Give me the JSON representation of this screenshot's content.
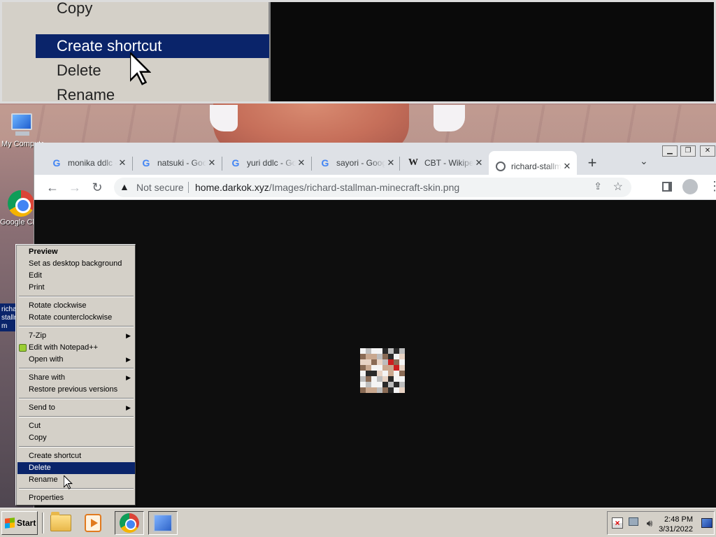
{
  "magnifier": {
    "items": [
      {
        "label": "Copy",
        "highlighted": false
      },
      {
        "label": "Create shortcut",
        "highlighted": true
      },
      {
        "label": "Delete",
        "highlighted": false
      },
      {
        "label": "Rename",
        "highlighted": false
      }
    ]
  },
  "desktop": {
    "icons": [
      {
        "label": "My Computer",
        "icon": "computer-icon"
      },
      {
        "label": "Google Chrome",
        "icon": "chrome-icon"
      }
    ],
    "selected_file_label": "richard-stallman-m"
  },
  "browser": {
    "tabs": [
      {
        "title": "monika ddlc - Google Search",
        "favicon": "google-icon",
        "active": false
      },
      {
        "title": "natsuki - Google Search",
        "favicon": "google-icon",
        "active": false
      },
      {
        "title": "yuri ddlc - Google Search",
        "favicon": "google-icon",
        "active": false
      },
      {
        "title": "sayori - Google Search",
        "favicon": "google-icon",
        "active": false
      },
      {
        "title": "CBT - Wikipedia",
        "favicon": "wikipedia-icon",
        "active": false
      },
      {
        "title": "richard-stallman-minecraft-skin.png",
        "favicon": "globe-icon",
        "active": true
      }
    ],
    "security_label": "Not secure",
    "url_host": "home.darkok.xyz",
    "url_path": "/Images/richard-stallman-minecraft-skin.png",
    "image_alt": "richard-stallman-minecraft-skin.png"
  },
  "context_menu": {
    "groups": [
      [
        {
          "label": "Preview",
          "bold": true
        },
        {
          "label": "Set as desktop background"
        },
        {
          "label": "Edit"
        },
        {
          "label": "Print"
        }
      ],
      [
        {
          "label": "Rotate clockwise"
        },
        {
          "label": "Rotate counterclockwise"
        }
      ],
      [
        {
          "label": "7-Zip",
          "submenu": true
        },
        {
          "label": "Edit with Notepad++",
          "icon": "notepadpp-icon"
        },
        {
          "label": "Open with",
          "submenu": true
        }
      ],
      [
        {
          "label": "Share with",
          "submenu": true
        },
        {
          "label": "Restore previous versions"
        }
      ],
      [
        {
          "label": "Send to",
          "submenu": true
        }
      ],
      [
        {
          "label": "Cut"
        },
        {
          "label": "Copy"
        }
      ],
      [
        {
          "label": "Create shortcut"
        },
        {
          "label": "Delete",
          "highlighted": true
        },
        {
          "label": "Rename"
        }
      ],
      [
        {
          "label": "Properties"
        }
      ]
    ]
  },
  "taskbar": {
    "start_label": "Start",
    "quick_launch": [
      "explorer-icon",
      "media-player-icon",
      "chrome-icon",
      "magnifier-icon"
    ],
    "clock_time": "2:48 PM",
    "clock_date": "3/31/2022"
  },
  "colors": {
    "menu_bg": "#d4d0c8",
    "highlight": "#0a246a",
    "browser_frame": "#dee1e6",
    "viewer_bg": "#0e0e0e"
  }
}
